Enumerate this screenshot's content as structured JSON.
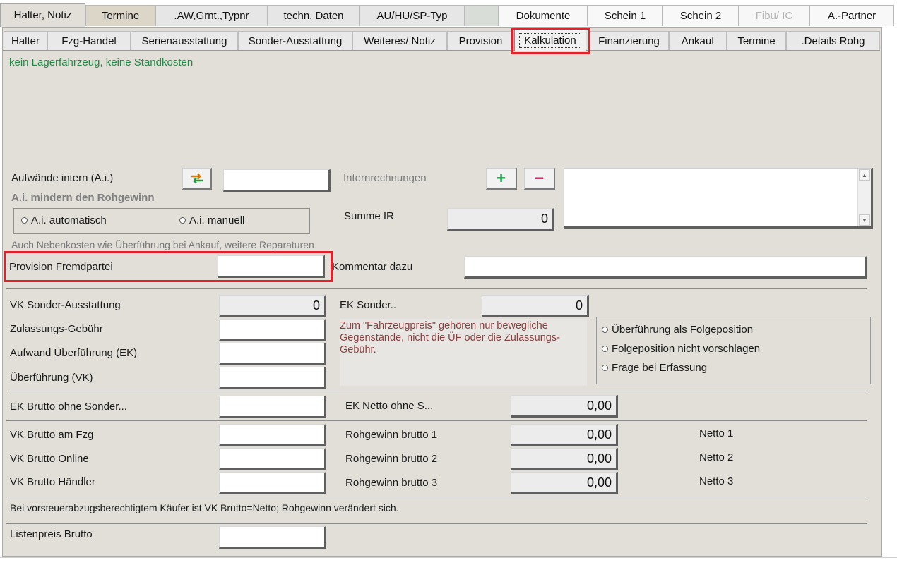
{
  "top_tabs": [
    {
      "label": "Halter, Notiz"
    },
    {
      "label": "Termine"
    },
    {
      "label": ".AW,Grnt.,Typnr"
    },
    {
      "label": "techn. Daten"
    },
    {
      "label": "AU/HU/SP-Typ"
    },
    {
      "label": ""
    },
    {
      "label": "Dokumente"
    },
    {
      "label": "Schein 1"
    },
    {
      "label": "Schein 2"
    },
    {
      "label": "Fibu/ IC"
    },
    {
      "label": "A.-Partner"
    }
  ],
  "sub_tabs": [
    {
      "label": "Halter"
    },
    {
      "label": "Fzg-Handel"
    },
    {
      "label": "Serienausstattung"
    },
    {
      "label": "Sonder-Ausstattung"
    },
    {
      "label": "Weiteres/ Notiz"
    },
    {
      "label": "Provision"
    },
    {
      "label": "Kalkulation"
    },
    {
      "label": "Finanzierung"
    },
    {
      "label": "Ankauf"
    },
    {
      "label": "Termine"
    },
    {
      "label": ".Details Rohg"
    }
  ],
  "status_text": "kein Lagerfahrzeug, keine Standkosten",
  "aufwaende": {
    "label": "Aufwände intern (A.i.)",
    "note": "A.i. mindern den Rohgewinn",
    "radio_auto": "A.i. automatisch",
    "radio_manual": "A.i. manuell",
    "hint": "Auch Nebenkosten wie Überführung bei Ankauf, weitere Reparaturen"
  },
  "internrechnungen": {
    "label": "Internrechnungen",
    "add_label": "+",
    "remove_label": "−",
    "summe_label": "Summe IR",
    "summe_value": "0"
  },
  "provision": {
    "label": "Provision Fremdpartei",
    "kommentar_label": "Kommentar dazu"
  },
  "vk_sonder": {
    "label": "VK Sonder-Ausstattung",
    "value": "0"
  },
  "ek_sonder": {
    "label": "EK Sonder..",
    "value": "0"
  },
  "zulassung_label": "Zulassungs-Gebühr",
  "aufwand_ueberfuehrung_label": "Aufwand Überführung (EK)",
  "ueberfuehrung_vk_label": "Überführung (VK)",
  "info_text": "Zum \"Fahrzeugpreis\" gehören nur bewegliche Gegenstände, nicht die ÜF oder die Zulassungs-Gebühr.",
  "ueberfuehrung_options": [
    "Überführung als Folgeposition",
    "Folgeposition nicht vorschlagen",
    "Frage bei Erfassung"
  ],
  "ek_brutto_label": "EK Brutto ohne Sonder...",
  "ek_netto": {
    "label": "EK Netto ohne S...",
    "value": "0,00"
  },
  "vk_brutto_fzg_label": "VK Brutto am Fzg",
  "vk_brutto_online_label": "VK Brutto Online",
  "vk_brutto_haendler_label": "VK Brutto Händler",
  "rohgewinn": [
    {
      "label": "Rohgewinn brutto 1",
      "value": "0,00",
      "netto": "Netto 1"
    },
    {
      "label": "Rohgewinn brutto 2",
      "value": "0,00",
      "netto": "Netto 2"
    },
    {
      "label": "Rohgewinn brutto 3",
      "value": "0,00",
      "netto": "Netto 3"
    }
  ],
  "footer_note": "Bei vorsteuerabzugsberechtigtem Käufer ist VK Brutto=Netto; Rohgewinn verändert sich.",
  "listenpreis_label": "Listenpreis Brutto",
  "colors": {
    "panel_bg": "#e2dfd9",
    "status_green": "#1f8a45",
    "info_maroon": "#8a3f3f",
    "highlight_red": "#e5202a",
    "plus_green": "#1aa34a",
    "minus_red": "#d4145a"
  }
}
